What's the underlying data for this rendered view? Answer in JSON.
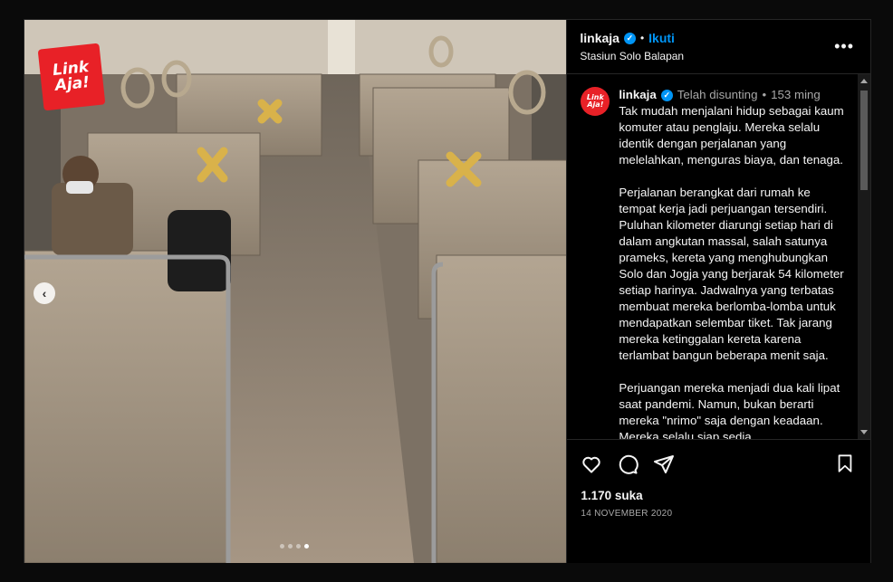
{
  "brand": {
    "logo_line1": "Link",
    "logo_line2": "Aja!",
    "color": "#e82127"
  },
  "header": {
    "username": "linkaja",
    "verified_icon": "verified-badge-icon",
    "separator": "•",
    "follow_label": "Ikuti",
    "location": "Stasiun Solo Balapan",
    "more_icon": "more-options-icon",
    "more_label": "•••"
  },
  "caption": {
    "username": "linkaja",
    "edited": "Telah disunting",
    "time": "153 ming",
    "paragraphs": [
      "Tak mudah menjalani hidup sebagai kaum komuter atau penglaju. Mereka selalu identik dengan perjalanan yang melelahkan, menguras biaya, dan tenaga.",
      "Perjalanan berangkat dari rumah ke tempat kerja jadi perjuangan tersendiri. Puluhan kilometer diarungi setiap hari di dalam angkutan massal, salah satunya prameks, kereta yang menghubungkan Solo dan Jogja yang berjarak 54 kilometer setiap harinya. Jadwalnya yang terbatas membuat mereka berlomba-lomba untuk mendapatkan selembar tiket. Tak jarang mereka ketinggalan kereta karena terlambat bangun beberapa menit saja.",
      "Perjuangan mereka menjadi dua kali lipat saat pandemi. Namun, bukan berarti mereka \"nrimo\" saja dengan keadaan. Mereka selalu siap sedia"
    ]
  },
  "media": {
    "carousel_total": 4,
    "carousel_active": 4,
    "prev_label": "‹"
  },
  "actions": {
    "icons": [
      "heart-icon",
      "comment-icon",
      "share-icon",
      "bookmark-icon"
    ],
    "likes": "1.170 suka",
    "date": "14 NOVEMBER 2020"
  }
}
